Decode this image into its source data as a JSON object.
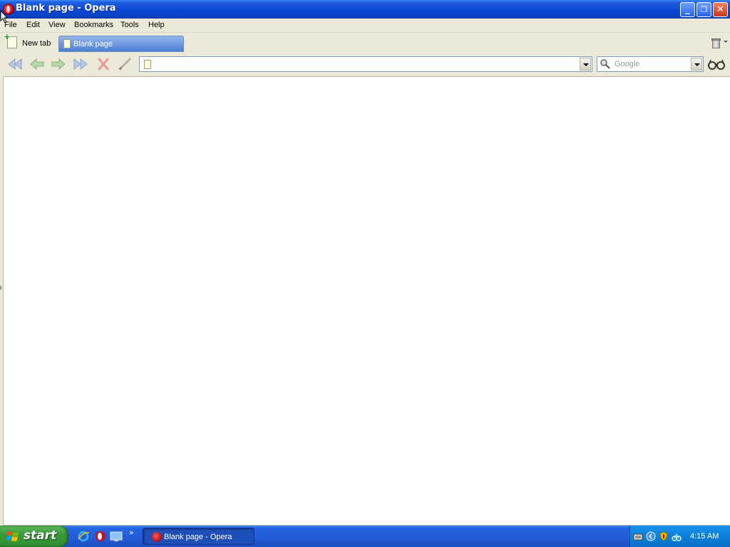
{
  "window": {
    "title": "Blank page - Opera"
  },
  "menu": {
    "items": [
      "File",
      "Edit",
      "View",
      "Bookmarks",
      "Tools",
      "Help"
    ]
  },
  "tabs": {
    "new_tab_label": "New tab",
    "open": [
      {
        "label": "Blank page",
        "active": true
      }
    ]
  },
  "address": {
    "value": "",
    "placeholder": ""
  },
  "search": {
    "value": "",
    "placeholder": "Google",
    "engine": "Google"
  },
  "taskbar": {
    "start_label": "start",
    "quick_launch_more": "»",
    "items": [
      {
        "label": "Blank page - Opera"
      }
    ],
    "clock": "4:15 AM"
  },
  "colors": {
    "titlebar": "#0a49d6",
    "taskbar": "#245edb",
    "start": "#3a9a3a",
    "tab_active": "#4c7fd6"
  }
}
